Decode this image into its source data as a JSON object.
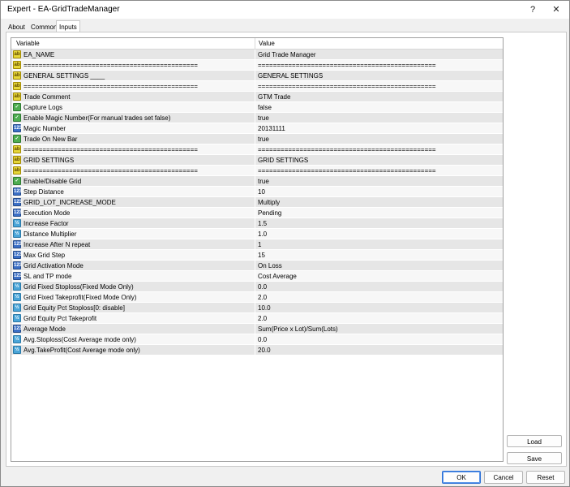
{
  "window": {
    "title": "Expert - EA-GridTradeManager",
    "help_glyph": "?",
    "close_glyph": "✕"
  },
  "tabs": [
    {
      "label": "About"
    },
    {
      "label": "Common"
    },
    {
      "label": "Inputs"
    }
  ],
  "grid": {
    "col_variable": "Variable",
    "col_value": "Value",
    "rows": [
      {
        "type": "str",
        "icon": "ab",
        "name": "EA_NAME",
        "value": "Grid Trade Manager"
      },
      {
        "type": "str",
        "icon": "ab",
        "name": "==============================================",
        "value": "==============================================="
      },
      {
        "type": "str",
        "icon": "ab",
        "name": "GENERAL SETTINGS ____",
        "value": "GENERAL SETTINGS"
      },
      {
        "type": "str",
        "icon": "ab",
        "name": "==============================================",
        "value": "==============================================="
      },
      {
        "type": "str",
        "icon": "ab",
        "name": "Trade Comment",
        "value": "GTM Trade"
      },
      {
        "type": "bool",
        "icon": "✓",
        "name": "Capture Logs",
        "value": "false"
      },
      {
        "type": "bool",
        "icon": "✓",
        "name": "Enable Magic Number(For manual trades set false)",
        "value": "true"
      },
      {
        "type": "int",
        "icon": "123",
        "name": "Magic Number",
        "value": "20131111"
      },
      {
        "type": "bool",
        "icon": "✓",
        "name": "Trade On New Bar",
        "value": "true"
      },
      {
        "type": "str",
        "icon": "ab",
        "name": "==============================================",
        "value": "==============================================="
      },
      {
        "type": "str",
        "icon": "ab",
        "name": "GRID SETTINGS",
        "value": "GRID SETTINGS"
      },
      {
        "type": "str",
        "icon": "ab",
        "name": "==============================================",
        "value": "==============================================="
      },
      {
        "type": "bool",
        "icon": "✓",
        "name": "Enable/Disable Grid",
        "value": "true"
      },
      {
        "type": "int",
        "icon": "123",
        "name": "Step Distance",
        "value": "10"
      },
      {
        "type": "enum",
        "icon": "123",
        "name": "GRID_LOT_INCREASE_MODE",
        "value": "Multiply"
      },
      {
        "type": "enum",
        "icon": "123",
        "name": "Execution Mode",
        "value": "Pending"
      },
      {
        "type": "dbl",
        "icon": "½",
        "name": "Increase Factor",
        "value": "1.5"
      },
      {
        "type": "dbl",
        "icon": "½",
        "name": "Distance Multiplier",
        "value": "1.0"
      },
      {
        "type": "int",
        "icon": "123",
        "name": "Increase After N repeat",
        "value": "1"
      },
      {
        "type": "int",
        "icon": "123",
        "name": "Max Grid Step",
        "value": "15"
      },
      {
        "type": "enum",
        "icon": "123",
        "name": "Grid Activation Mode",
        "value": "On Loss"
      },
      {
        "type": "enum",
        "icon": "123",
        "name": "SL and TP mode",
        "value": "Cost Average"
      },
      {
        "type": "dbl",
        "icon": "½",
        "name": "Grid Fixed Stoploss(Fixed Mode Only)",
        "value": "0.0"
      },
      {
        "type": "dbl",
        "icon": "½",
        "name": "Grid Fixed Takeprofit(Fixed Mode Only)",
        "value": "2.0"
      },
      {
        "type": "dbl",
        "icon": "½",
        "name": "Grid Equity Pct Stoploss[0: disable]",
        "value": "10.0"
      },
      {
        "type": "dbl",
        "icon": "½",
        "name": "Grid Equity Pct Takeprofit",
        "value": "2.0"
      },
      {
        "type": "enum",
        "icon": "123",
        "name": "Average Mode",
        "value": "Sum(Price x Lot)/Sum(Lots)"
      },
      {
        "type": "dbl",
        "icon": "½",
        "name": "Avg.Stoploss(Cost Average mode only)",
        "value": "0.0"
      },
      {
        "type": "dbl",
        "icon": "½",
        "name": "Avg.TakeProfit(Cost Average mode only)",
        "value": "20.0"
      }
    ]
  },
  "side_buttons": {
    "load": "Load",
    "save": "Save"
  },
  "bottom_buttons": {
    "ok": "OK",
    "cancel": "Cancel",
    "reset": "Reset"
  }
}
